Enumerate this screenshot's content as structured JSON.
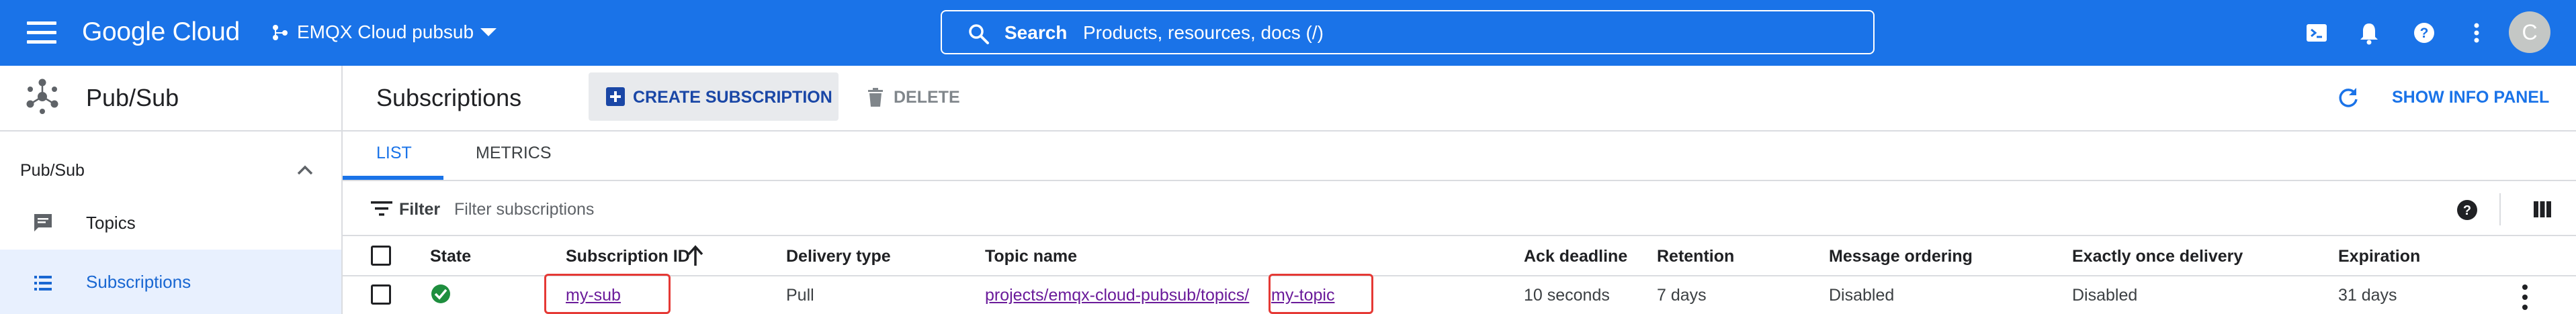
{
  "header": {
    "logo": "Google Cloud",
    "project": "EMQX Cloud pubsub",
    "search_label": "Search",
    "search_placeholder": "Products, resources, docs (/)",
    "avatar_initial": "C"
  },
  "sidebar": {
    "product_title": "Pub/Sub",
    "section_label": "Pub/Sub",
    "items": [
      {
        "label": "Topics"
      },
      {
        "label": "Subscriptions",
        "selected": true
      }
    ]
  },
  "page": {
    "title": "Subscriptions",
    "create_label": "CREATE SUBSCRIPTION",
    "delete_label": "DELETE",
    "info_panel_label": "SHOW INFO PANEL"
  },
  "tabs": [
    {
      "label": "LIST",
      "active": true
    },
    {
      "label": "METRICS",
      "active": false
    }
  ],
  "filter": {
    "label": "Filter",
    "placeholder": "Filter subscriptions"
  },
  "table": {
    "columns": [
      "State",
      "Subscription ID",
      "Delivery type",
      "Topic name",
      "Ack deadline",
      "Retention",
      "Message ordering",
      "Exactly once delivery",
      "Expiration"
    ],
    "rows": [
      {
        "state": "active",
        "subscription_id": "my-sub",
        "delivery_type": "Pull",
        "topic_prefix": "projects/emqx-cloud-pubsub/topics/",
        "topic_name": "my-topic",
        "ack_deadline": "10 seconds",
        "retention": "7 days",
        "message_ordering": "Disabled",
        "exactly_once": "Disabled",
        "expiration": "31 days"
      }
    ]
  },
  "colors": {
    "primary": "#1a73e8",
    "active_status": "#1e8e3e",
    "highlight": "#e53935",
    "visited_link": "#6a1b9a"
  }
}
